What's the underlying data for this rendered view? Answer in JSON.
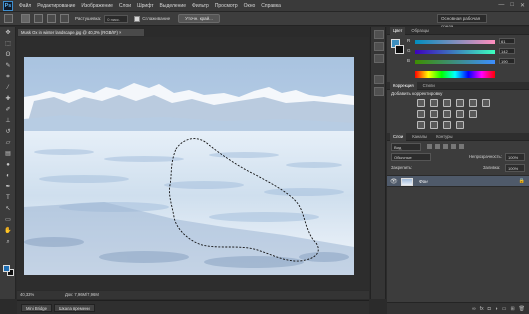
{
  "app": {
    "logo": "Ps"
  },
  "menu": {
    "items": [
      "Файл",
      "Редактирование",
      "Изображение",
      "Слои",
      "Шрифт",
      "Выделение",
      "Фильтр",
      "Просмотр",
      "Окно",
      "Справка"
    ]
  },
  "window_controls": {
    "minimize": "—",
    "restore": "□",
    "close": "✕"
  },
  "options": {
    "feather_label": "Растушевка:",
    "feather_value": "0 пикс.",
    "antialias_label": "Сглаживание",
    "refine_button": "Уточн. край...",
    "workspace": "Основная рабочая среда"
  },
  "tools": [
    {
      "icon": "move-tool-icon",
      "glyph": "✥"
    },
    {
      "icon": "marquee-tool-icon",
      "glyph": "⬚"
    },
    {
      "icon": "lasso-tool-icon",
      "glyph": "ʘ"
    },
    {
      "icon": "quick-select-tool-icon",
      "glyph": "✎"
    },
    {
      "icon": "crop-tool-icon",
      "glyph": "⌗"
    },
    {
      "icon": "eyedropper-tool-icon",
      "glyph": "⁄"
    },
    {
      "icon": "healing-brush-tool-icon",
      "glyph": "✚"
    },
    {
      "icon": "brush-tool-icon",
      "glyph": "✐"
    },
    {
      "icon": "clone-stamp-tool-icon",
      "glyph": "⊥"
    },
    {
      "icon": "history-brush-tool-icon",
      "glyph": "↺"
    },
    {
      "icon": "eraser-tool-icon",
      "glyph": "▱"
    },
    {
      "icon": "gradient-tool-icon",
      "glyph": "▤"
    },
    {
      "icon": "blur-tool-icon",
      "glyph": "●"
    },
    {
      "icon": "dodge-tool-icon",
      "glyph": "◐"
    },
    {
      "icon": "pen-tool-icon",
      "glyph": "✒"
    },
    {
      "icon": "type-tool-icon",
      "glyph": "T"
    },
    {
      "icon": "path-select-tool-icon",
      "glyph": "↖"
    },
    {
      "icon": "shape-tool-icon",
      "glyph": "▭"
    },
    {
      "icon": "hand-tool-icon",
      "glyph": "✋"
    },
    {
      "icon": "zoom-tool-icon",
      "glyph": "⌕"
    }
  ],
  "document": {
    "tab_title": "Musk Ox in winter landscape.jpg @ 40,3% (RGB/8*) ×",
    "zoom": "40,33%",
    "doc_size": "Док: 7,96M/7,96M",
    "bottom_tabs": [
      "Mini Bridge",
      "Шкала времени"
    ]
  },
  "color_panel": {
    "tabs": [
      "Цвет",
      "Образцы"
    ],
    "r_label": "R",
    "g_label": "G",
    "b_label": "B",
    "r_value": "61",
    "g_value": "142",
    "b_value": "190",
    "fg_color": "#3d8ebe"
  },
  "adjustments_panel": {
    "tabs": [
      "Коррекция",
      "Стили"
    ],
    "heading": "Добавить корректировку"
  },
  "layers_panel": {
    "tabs": [
      "Слои",
      "Каналы",
      "Контуры"
    ],
    "kind_label": "Вид",
    "blend_mode": "Обычные",
    "opacity_label": "Непрозрачность:",
    "opacity_value": "100%",
    "lock_label": "Закрепить:",
    "fill_label": "Заливка:",
    "fill_value": "100%",
    "layer_name": "Фон"
  }
}
